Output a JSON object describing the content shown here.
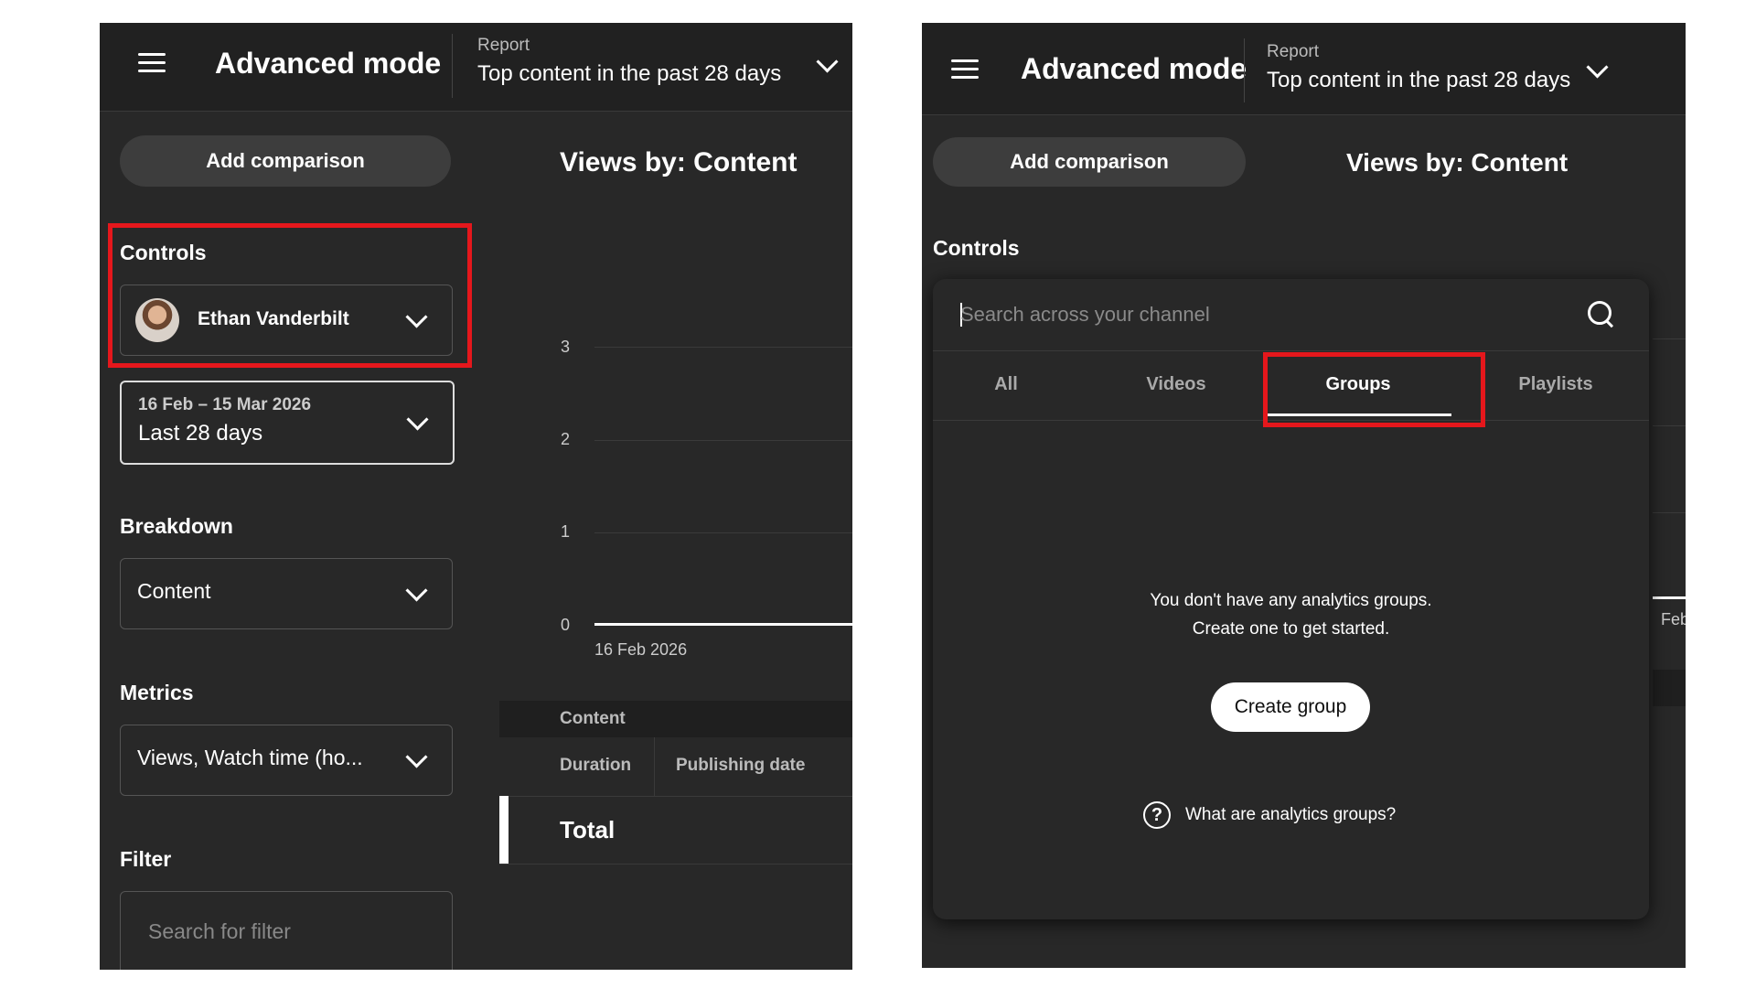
{
  "left": {
    "header": {
      "app_title": "Advanced mode",
      "report_label": "Report",
      "report_title": "Top content in the past 28 days"
    },
    "add_comparison": "Add comparison",
    "controls_label": "Controls",
    "channel_name": "Ethan Vanderbilt",
    "date_range": {
      "dates": "16 Feb – 15 Mar 2026",
      "label": "Last 28 days"
    },
    "breakdown_label": "Breakdown",
    "breakdown_value": "Content",
    "metrics_label": "Metrics",
    "metrics_value": "Views, Watch time (ho...",
    "filter_label": "Filter",
    "filter_placeholder": "Search for filter",
    "chart_title": "Views by: Content",
    "table": {
      "group_header": "Content",
      "columns": [
        "Duration",
        "Publishing date"
      ],
      "total_label": "Total"
    }
  },
  "chart_data": {
    "type": "line",
    "title": "Views by: Content",
    "x": [
      "16 Feb 2026"
    ],
    "y_ticks": [
      0,
      1,
      2,
      3
    ],
    "ylim": [
      0,
      3
    ],
    "series": [
      {
        "values": [
          0,
          0
        ]
      }
    ],
    "grid": true
  },
  "right": {
    "header": {
      "app_title": "Advanced mode",
      "report_label": "Report",
      "report_title": "Top content in the past 28 days"
    },
    "add_comparison": "Add comparison",
    "chart_title": "Views by: Content",
    "controls_label": "Controls",
    "search_placeholder": "Search across your channel",
    "tabs": [
      "All",
      "Videos",
      "Groups",
      "Playlists"
    ],
    "active_tab": "Groups",
    "empty_line1": "You don't have any analytics groups.",
    "empty_line2": "Create one to get started.",
    "create_group": "Create group",
    "help_link": "What are analytics groups?",
    "behind_axis_label": "Feb"
  },
  "colors": {
    "panel_bg": "#282828",
    "header_bg": "#212121",
    "highlight": "#e5171c",
    "accent_white": "#ffffff"
  },
  "icons": [
    "menu-icon",
    "chevron-down-icon",
    "search-icon",
    "help-circle-icon",
    "avatar"
  ]
}
